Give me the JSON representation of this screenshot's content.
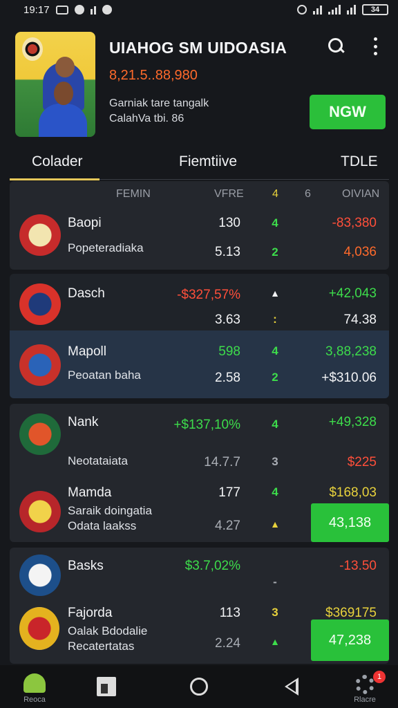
{
  "status": {
    "time": "19:17",
    "battery": "34"
  },
  "header": {
    "title": "UIAHOG SM UIDOASIA",
    "price": "8,21.5..88,980",
    "subtitle": "Garniak tare tangalk\nCalahVa tbi. 86",
    "new_button": "NGW"
  },
  "tabs": [
    {
      "label": "Colader"
    },
    {
      "label": "Fiemtiive"
    },
    {
      "label": "TDLE"
    }
  ],
  "columns": {
    "name": "FEMIN",
    "value": "VFRE",
    "c1": "4",
    "c2": "6",
    "change": "OIVIAN"
  },
  "rows": [
    {
      "name": "Baopi",
      "sub": "Popeteradiaka",
      "v1": "130",
      "v2": "5.13",
      "i1": "4",
      "i2": "2",
      "c1": "-83,380",
      "c2": "4,036",
      "crest": "#c62b2b",
      "crest2": "#f2e5b0"
    },
    {
      "name": "Dasch",
      "v1": "-$327,57%",
      "v2": "3.63",
      "i1": "▲",
      "i2": ":",
      "c1": "+42,043",
      "c2": "74.38",
      "crest": "#d9322a",
      "crest2": "#1f3a7a"
    },
    {
      "name": "Mapoll",
      "sub": "Peoatan baha",
      "v1": "598",
      "v2": "2.58",
      "i1": "4",
      "i2": "2",
      "c1": "3,88,238",
      "c2": "+$310.06",
      "crest": "#c8312a",
      "crest2": "#2a63b8"
    },
    {
      "name": "Nank",
      "sub": "Neotataiata",
      "v1": "+$137,10%",
      "v2": "14.7.7",
      "i1": "4",
      "i2": "3",
      "c1": "+49,328",
      "c2": "$225",
      "crest": "#1f6a3a",
      "crest2": "#e1552a"
    },
    {
      "name": "Mamda",
      "sub": "Saraik doingatia\nOdata laakss",
      "v1": "177",
      "v2": "4.27",
      "i1": "4",
      "i2": "▲",
      "c1": "$168,03",
      "c2": "43,138",
      "crest": "#b7262a",
      "crest2": "#f1d24a"
    },
    {
      "name": "Basks",
      "v1": "$3.7,02%",
      "i1": "-",
      "c1": "-13.50",
      "crest": "#1d4f8a",
      "crest2": "#f4f4f4"
    },
    {
      "name": "Fajorda",
      "sub": "Oalak Bdodalie\nRecatertatas",
      "v1": "113",
      "v2": "2.24",
      "i1": "3",
      "i2": "▲",
      "c1": "$369175",
      "c2": "47,238",
      "crest": "#e4b21f",
      "crest2": "#c9252a"
    }
  ],
  "nav": {
    "home": "Reoca",
    "profile": "Rlacre",
    "badge": "1"
  },
  "colors": {
    "accent_green": "#2bbf3a",
    "price_orange": "#ff6a2b",
    "tab_underline": "#e6c85a"
  }
}
